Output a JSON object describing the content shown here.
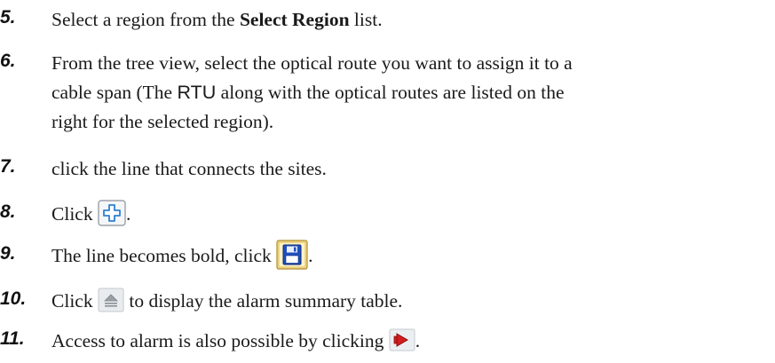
{
  "steps": [
    {
      "number": "5.",
      "text_before": "Select a region from the ",
      "bold_text": "Select Region",
      "text_after": " list."
    },
    {
      "number": "6.",
      "line1_a": "From the tree view, select the optical route you want to assign it to a",
      "line2_a": "cable span (The ",
      "line2_sans": "RTU",
      "line2_b": " along with the optical routes are listed on the",
      "line3": "right for the selected region)."
    },
    {
      "number": "7.",
      "text": "click the line that connects the sites."
    },
    {
      "number": "8.",
      "text_before": "Click ",
      "icon": "add-plus-icon",
      "text_after": "."
    },
    {
      "number": "9.",
      "text_before": "The line becomes bold, click ",
      "icon": "save-floppy-icon",
      "text_after": "."
    },
    {
      "number": "10.",
      "text_before": "Click ",
      "icon": "eject-expand-icon",
      "text_after": " to display the alarm summary table."
    },
    {
      "number": "11.",
      "text_before": "Access to alarm is also possible by clicking ",
      "icon": "alarm-arrow-icon",
      "text_after": "."
    }
  ],
  "colors": {
    "plus_icon": "#2f7fd1",
    "save_icon": "#1f4fbf",
    "alarm_icon": "#d21e1e"
  }
}
